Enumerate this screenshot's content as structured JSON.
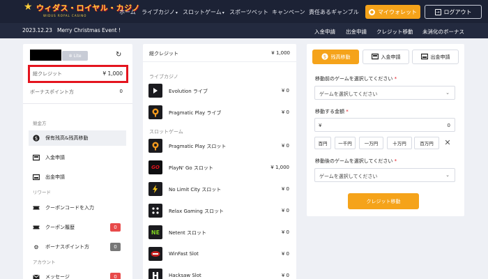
{
  "brand": {
    "name": "ウィダス・ロイヤル・カジノ",
    "tagline": "WIDUS ROYAL CASINO"
  },
  "nav": {
    "items": [
      {
        "label": "ホーム"
      },
      {
        "label": "ライブカジノ"
      },
      {
        "label": "スロットゲーム"
      },
      {
        "label": "スポーツベット"
      },
      {
        "label": "キャンペーン"
      },
      {
        "label": "責任あるギャンブル"
      }
    ],
    "wallet_label": "マイウォレット",
    "logout_label": "ログアウト"
  },
  "subbar": {
    "date": "2023.12.23",
    "event": "Merry Christmas Event !",
    "links": [
      "入金申請",
      "出金申請",
      "クレジット移動",
      "未消化のボーナス"
    ]
  },
  "account": {
    "badge": "Lite",
    "credit_label": "総クレジット",
    "credit_value": "¥ 1,000",
    "bonus_label": "ボーナスポイント方",
    "bonus_value": "0"
  },
  "sidebar": {
    "section_payment": "競金方",
    "payment_items": [
      {
        "label": "保有残高&残高移動",
        "icon": "dollar-icon"
      },
      {
        "label": "入金申請",
        "icon": "deposit-icon"
      },
      {
        "label": "出金申請",
        "icon": "withdraw-icon"
      }
    ],
    "section_reward": "リワード",
    "reward_items": [
      {
        "label": "クーポンコードを入力",
        "icon": "ticket-icon"
      },
      {
        "label": "クーポン履歴",
        "icon": "ticket-history-icon",
        "badge": "0"
      },
      {
        "label": "ボーナスポイント方",
        "icon": "gear-icon",
        "badge": "0"
      }
    ],
    "section_account": "アカウント",
    "account_items": [
      {
        "label": "メッセージ",
        "icon": "mail-icon",
        "badge": "0"
      }
    ]
  },
  "balances": {
    "total_label": "総クレジット",
    "total_value": "¥ 1,000",
    "section_live": "ライブカジノ",
    "live": [
      {
        "name": "Evolution ライブ",
        "amount": "¥ 0",
        "icon": "evolution-icon"
      },
      {
        "name": "Pragmatic Play ライブ",
        "amount": "¥ 0",
        "icon": "pragmatic-icon"
      }
    ],
    "section_slots": "スロットゲーム",
    "slots": [
      {
        "name": "Pragmatic Play スロット",
        "amount": "¥ 0",
        "icon": "pragmatic-icon"
      },
      {
        "name": "PlayN' Go スロット",
        "amount": "¥ 1,000",
        "icon": "playngo-icon"
      },
      {
        "name": "No Limit City スロット",
        "amount": "¥ 0",
        "icon": "lightning-icon"
      },
      {
        "name": "Relax Gaming スロット",
        "amount": "¥ 0",
        "icon": "dice-icon"
      },
      {
        "name": "Netent スロット",
        "amount": "¥ 0",
        "icon": "netent-icon"
      },
      {
        "name": "WinFast Slot",
        "amount": "¥ 0",
        "icon": "winfast-icon"
      },
      {
        "name": "Hacksaw Slot",
        "amount": "¥ 0",
        "icon": "hacksaw-icon"
      }
    ]
  },
  "transfer": {
    "tabs": [
      "残高移動",
      "入金申請",
      "出金申請"
    ],
    "from_label": "移動前のゲームを選択してください",
    "from_placeholder": "ゲームを選択してください",
    "amount_label": "移動する金額",
    "amount_currency": "¥",
    "amount_value": "0",
    "chips": [
      "百円",
      "一千円",
      "一万円",
      "十万円",
      "百万円"
    ],
    "to_label": "移動後のゲームを選択してください",
    "to_placeholder": "ゲームを選択してください",
    "submit_label": "クレジット移動",
    "required_mark": "*"
  },
  "colors": {
    "accent": "#f5a31a",
    "nav_bg": "#1c2235",
    "highlight": "#e4141e"
  }
}
